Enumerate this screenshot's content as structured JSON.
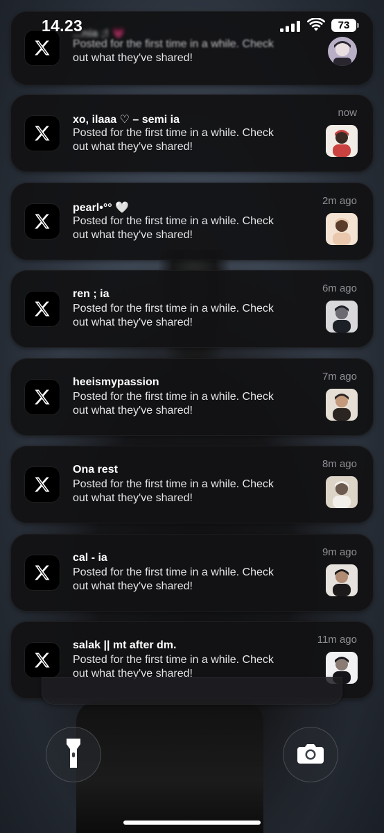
{
  "status_bar": {
    "time": "14.23",
    "battery_level": "73"
  },
  "notifications": [
    {
      "title": "xo, ilaaa ♡ – semi ia",
      "time": "now",
      "body_line1": "Posted for the first time in a while. Check",
      "body_line2": "out what they've shared!",
      "thumb_colors": [
        "#f1ece6",
        "#c9423f",
        "#3b2a24"
      ]
    },
    {
      "title": "pearl•°° 🤍",
      "time": "2m ago",
      "body_line1": "Posted for the first time in a while. Check",
      "body_line2": "out what they've shared!",
      "thumb_colors": [
        "#f4e3d3",
        "#e9c8ad",
        "#5a3c2c"
      ]
    },
    {
      "title": "ren ; ia",
      "time": "6m ago",
      "body_line1": "Posted for the first time in a while. Check",
      "body_line2": "out what they've shared!",
      "thumb_colors": [
        "#d9d9db",
        "#1d1f26",
        "#6a6a70"
      ]
    },
    {
      "title": "heeismypassion",
      "time": "7m ago",
      "body_line1": "Posted for the first time in a while. Check",
      "body_line2": "out what they've shared!",
      "thumb_colors": [
        "#e6dfd5",
        "#2b2522",
        "#c49a7c"
      ]
    },
    {
      "title": "Ona rest",
      "time": "8m ago",
      "body_line1": "Posted for the first time in a while. Check",
      "body_line2": "out what they've shared!",
      "thumb_colors": [
        "#ddd4c8",
        "#f2efea",
        "#6b5a4d"
      ]
    },
    {
      "title": "cal - ia",
      "time": "9m ago",
      "body_line1": "Posted for the first time in a while. Check",
      "body_line2": "out what they've shared!",
      "thumb_colors": [
        "#e6e3df",
        "#1c1a1a",
        "#b08c74"
      ]
    },
    {
      "title": "salak || mt after dm.",
      "time": "11m ago",
      "body_line1": "Posted for the first time in a while. Check",
      "body_line2": "out what they've shared!",
      "thumb_colors": [
        "#f1f1f3",
        "#15151a",
        "#8a7b74"
      ]
    }
  ],
  "top_notification": {
    "title": "...nia ;! 💗",
    "body_line1": "Posted for the first time in a while. Check",
    "body_line2": "out what they've shared!",
    "thumb_colors": [
      "#b9b0c8",
      "#2a2630",
      "#e9dfe0"
    ]
  },
  "app_icon": "x-logo-icon",
  "controls": {
    "left": "flashlight-icon",
    "right": "camera-icon"
  },
  "colors": {
    "card_background": "#121214",
    "time_gray": "#8e8e93",
    "text_white": "#ffffff"
  }
}
